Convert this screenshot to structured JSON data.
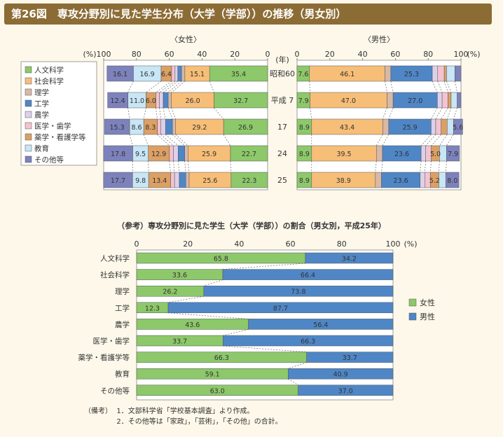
{
  "title": "第26図　専攻分野別に見た学生分布（大学（学部））の推移（男女別）",
  "colors": {
    "人文科学": "#8dc86a",
    "社会科学": "#f7be78",
    "理学": "#d8b8a6",
    "工学": "#4f86c6",
    "農学": "#ddd0ea",
    "医学・歯学": "#f3c3d0",
    "薬学・看護学等": "#dca064",
    "教育": "#c8e6f5",
    "その他等": "#7d82bc"
  },
  "chart_data": [
    {
      "type": "bar",
      "stacked": true,
      "orientation": "horizontal",
      "panel": "female",
      "subtitle": "〈女性〉",
      "unit_label": "(%)",
      "year_axis_label": "(年)",
      "ticks": [
        "100",
        "80",
        "60",
        "40",
        "20",
        "0"
      ],
      "xlim": [
        100,
        0
      ],
      "legend": [
        "人文科学",
        "社会科学",
        "理学",
        "工学",
        "農学",
        "医学・歯学",
        "薬学・看護学等",
        "教育",
        "その他等"
      ],
      "legend_position": "left",
      "categories": [
        "昭和60",
        "平成 7",
        "17",
        "24",
        "25"
      ],
      "series": [
        {
          "name": "人文科学",
          "values": [
            35.4,
            32.7,
            26.9,
            22.7,
            22.3
          ],
          "labels": [
            "35.4",
            "32.7",
            "26.9",
            "22.7",
            "22.3"
          ]
        },
        {
          "name": "社会科学",
          "values": [
            15.1,
            26.0,
            29.2,
            25.9,
            25.6
          ],
          "labels": [
            "15.1",
            "26.0",
            "29.2",
            "25.9",
            "25.6"
          ]
        },
        {
          "name": "理学",
          "values": [
            2.0,
            2.0,
            2.0,
            2.0,
            2.0
          ],
          "labels": [
            "",
            "",
            "",
            "",
            ""
          ]
        },
        {
          "name": "工学",
          "values": [
            2.3,
            3.0,
            4.2,
            4.0,
            4.0
          ],
          "labels": [
            "",
            "",
            "",
            "",
            ""
          ]
        },
        {
          "name": "農学",
          "values": [
            1.7,
            2.3,
            2.8,
            2.9,
            2.9
          ],
          "labels": [
            "",
            "",
            "",
            "",
            ""
          ]
        },
        {
          "name": "医学・歯学",
          "values": [
            2.1,
            2.2,
            2.2,
            2.4,
            2.4
          ],
          "labels": [
            "",
            "",
            "",
            "",
            ""
          ]
        },
        {
          "name": "薬学・看護学等",
          "values": [
            6.4,
            6.0,
            8.3,
            12.9,
            13.4
          ],
          "labels": [
            "6.4",
            "6.0",
            "8.3",
            "12.9",
            "13.4"
          ]
        },
        {
          "name": "教育",
          "values": [
            16.9,
            11.0,
            8.6,
            9.5,
            9.8
          ],
          "labels": [
            "16.9",
            "11.0",
            "8.6",
            "9.5",
            "9.8"
          ]
        },
        {
          "name": "その他等",
          "values": [
            16.1,
            12.4,
            15.3,
            17.8,
            17.7
          ],
          "labels": [
            "16.1",
            "12.4",
            "15.3",
            "17.8",
            "17.7"
          ]
        }
      ]
    },
    {
      "type": "bar",
      "stacked": true,
      "orientation": "horizontal",
      "panel": "male",
      "subtitle": "〈男性〉",
      "unit_label": "(%)",
      "ticks": [
        "0",
        "20",
        "40",
        "60",
        "80",
        "100"
      ],
      "xlim": [
        0,
        100
      ],
      "categories": [
        "昭和60",
        "平成 7",
        "17",
        "24",
        "25"
      ],
      "series": [
        {
          "name": "人文科学",
          "values": [
            7.6,
            7.9,
            8.9,
            8.9,
            8.9
          ],
          "labels": [
            "7.6",
            "7.9",
            "8.9",
            "8.9",
            "8.9"
          ]
        },
        {
          "name": "社会科学",
          "values": [
            46.1,
            47.0,
            43.4,
            39.5,
            38.9
          ],
          "labels": [
            "46.1",
            "47.0",
            "43.4",
            "39.5",
            "38.9"
          ]
        },
        {
          "name": "理学",
          "values": [
            3.5,
            3.7,
            3.6,
            3.7,
            3.7
          ],
          "labels": [
            "",
            "",
            "",
            "",
            ""
          ]
        },
        {
          "name": "工学",
          "values": [
            25.3,
            27.0,
            25.9,
            23.6,
            23.6
          ],
          "labels": [
            "25.3",
            "27.0",
            "25.9",
            "23.6",
            "23.6"
          ]
        },
        {
          "name": "農学",
          "values": [
            3.3,
            2.9,
            2.8,
            2.8,
            2.8
          ],
          "labels": [
            "",
            "",
            "",
            "",
            ""
          ]
        },
        {
          "name": "医学・歯学",
          "values": [
            4.0,
            3.6,
            3.3,
            3.4,
            3.4
          ],
          "labels": [
            "",
            "",
            "",
            "5.0",
            "5.2"
          ]
        },
        {
          "name": "薬学・看護学等",
          "values": [
            1.4,
            1.9,
            3.7,
            5.0,
            5.2
          ],
          "labels": [
            "",
            "",
            "",
            "5.0",
            "5.2"
          ]
        },
        {
          "name": "教育",
          "values": [
            5.1,
            3.7,
            3.8,
            4.3,
            4.3
          ],
          "labels": [
            "",
            "",
            "",
            "",
            ""
          ]
        },
        {
          "name": "その他等",
          "values": [
            3.7,
            2.3,
            5.6,
            7.9,
            8.0
          ],
          "labels": [
            "",
            "",
            "5.6",
            "7.9",
            "8.0"
          ]
        }
      ]
    },
    {
      "type": "bar",
      "stacked": true,
      "orientation": "horizontal",
      "panel": "reference",
      "title": "（参考）専攻分野別に見た学生（大学（学部））の割合（男女別，平成25年）",
      "unit_label": "(%)",
      "ticks": [
        "0",
        "20",
        "40",
        "60",
        "80",
        "100"
      ],
      "xlim": [
        0,
        100
      ],
      "legend_position": "right",
      "categories": [
        "人文科学",
        "社会科学",
        "理学",
        "工学",
        "農学",
        "医学・歯学",
        "薬学・看護学等",
        "教育",
        "その他等"
      ],
      "series": [
        {
          "name": "女性",
          "color": "#8dc86a",
          "values": [
            65.8,
            33.6,
            26.2,
            12.3,
            43.6,
            33.7,
            66.3,
            59.1,
            63.0
          ]
        },
        {
          "name": "男性",
          "color": "#4f86c6",
          "values": [
            34.2,
            66.4,
            73.8,
            87.7,
            56.4,
            66.3,
            33.7,
            40.9,
            37.0
          ]
        }
      ]
    }
  ],
  "notes": {
    "prefix": "（備考）",
    "items": [
      "1．文部科学省「学校基本調査」より作成。",
      "2．その他等は「家政」，「芸術」，「その他」の合計。"
    ]
  }
}
